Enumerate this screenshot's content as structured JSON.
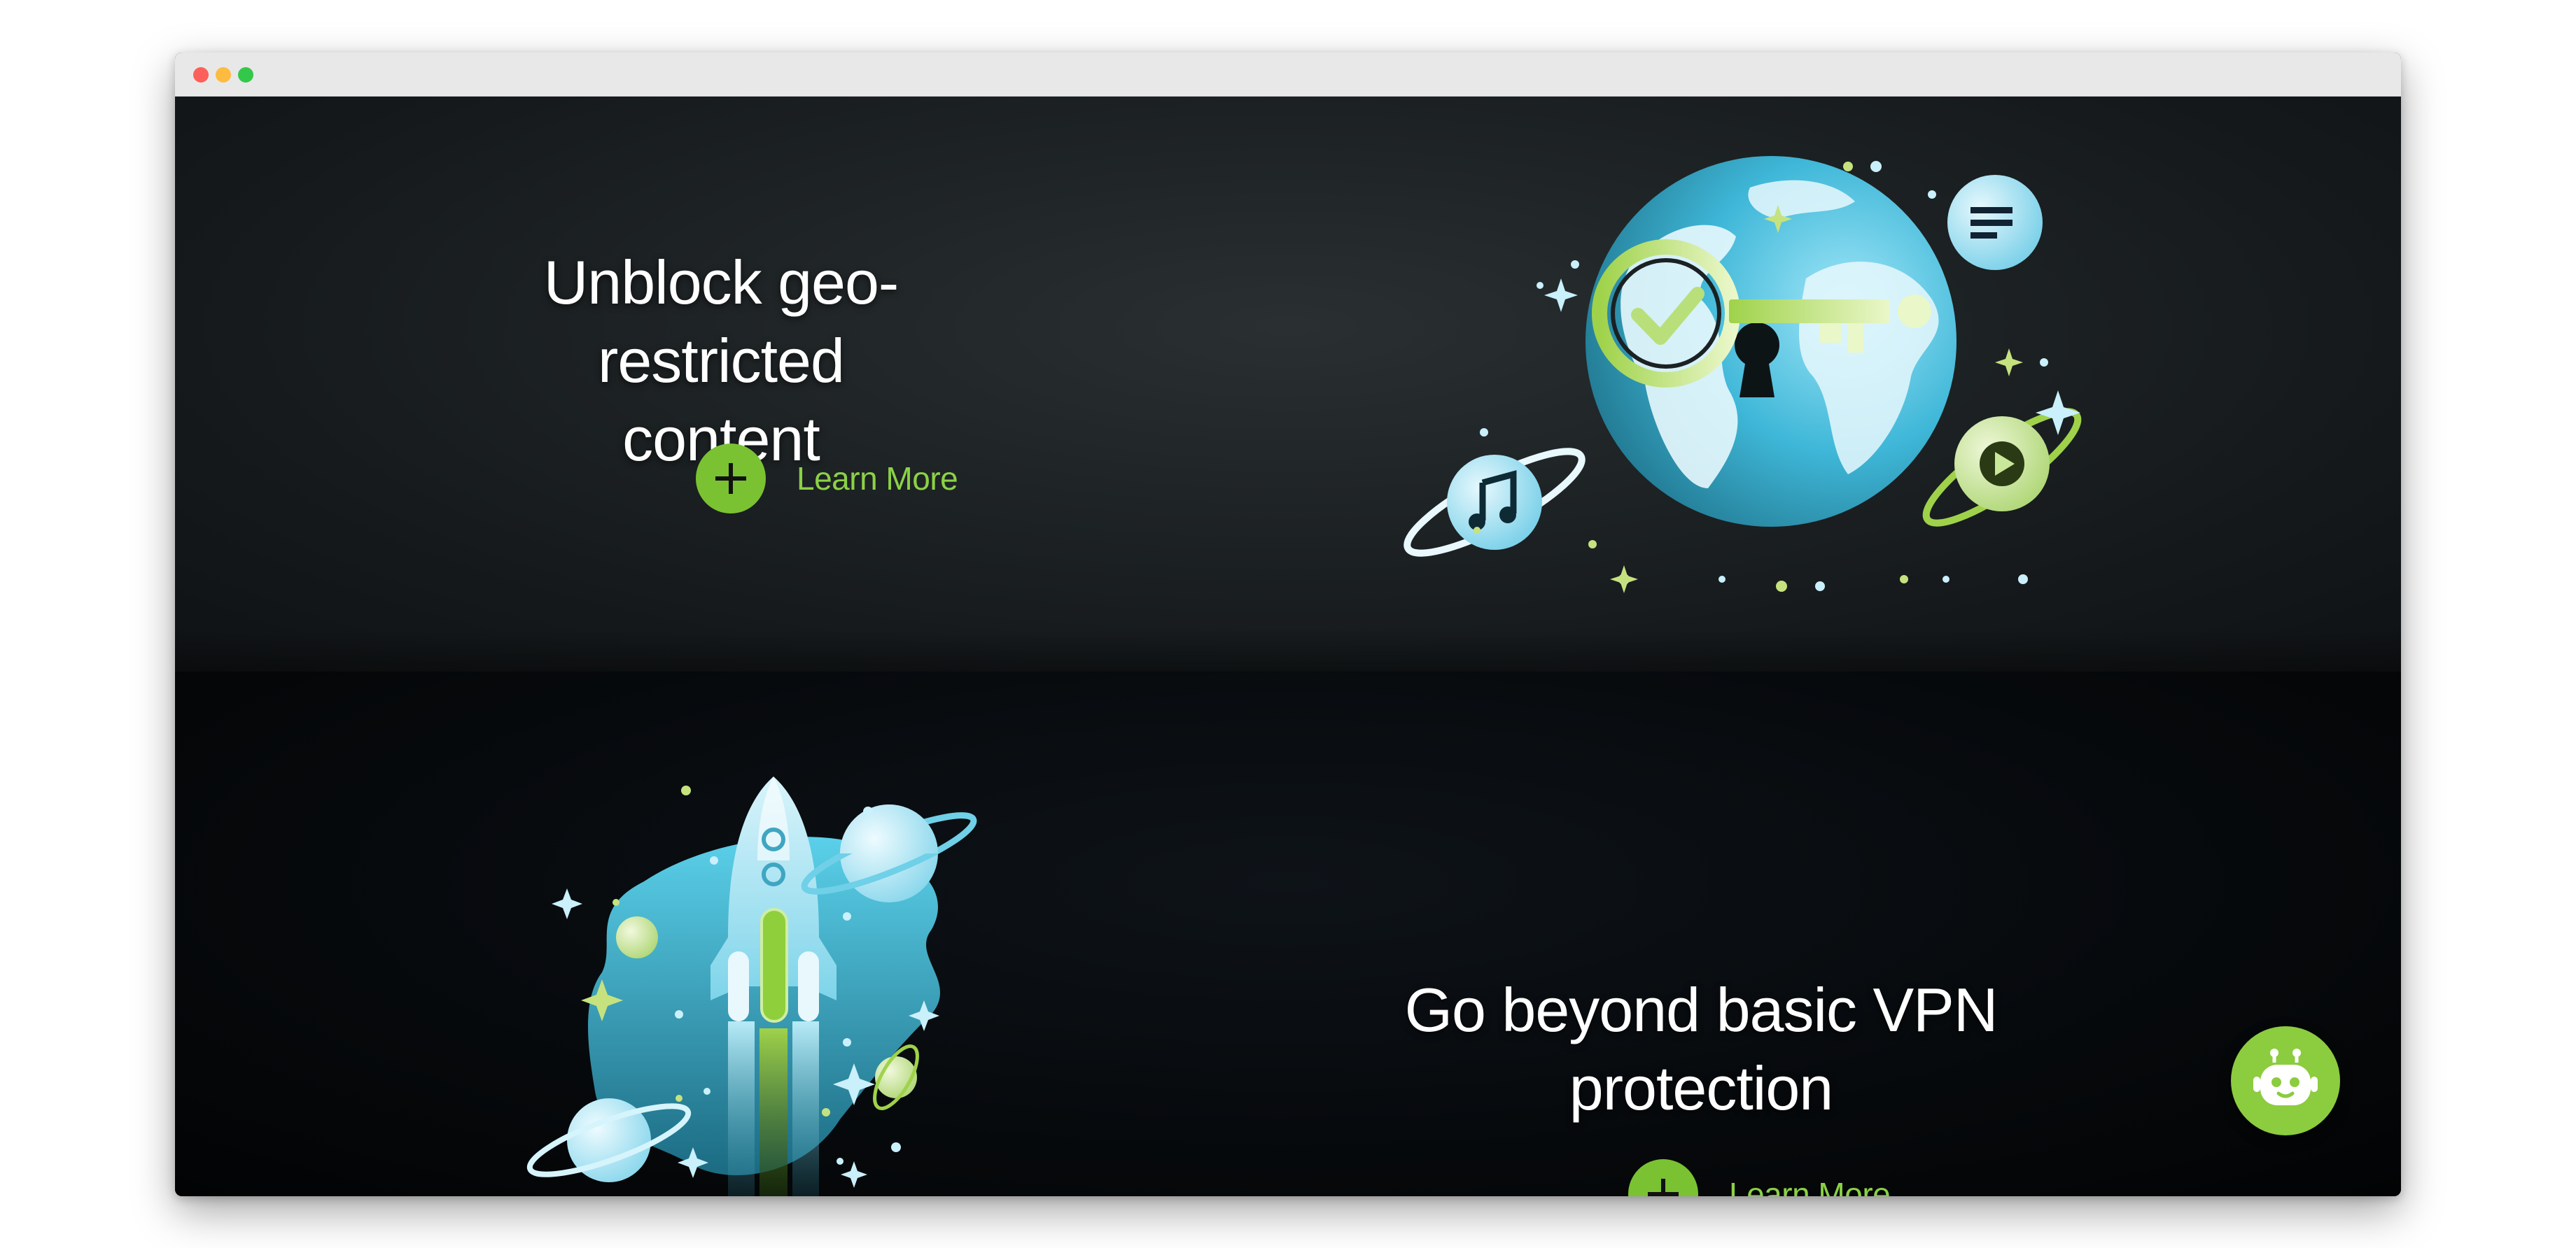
{
  "window": {
    "controls": [
      "close",
      "minimize",
      "zoom"
    ]
  },
  "hero_top": {
    "headline_line1": "Unblock geo-restricted",
    "headline_line2": "content",
    "cta_label": "Learn More",
    "illustration": "globe-key-planets-illustration"
  },
  "hero_bottom": {
    "headline_line1": "Go beyond basic VPN",
    "headline_line2": "protection",
    "cta_label": "Learn More",
    "illustration": "rocket-space-illustration"
  },
  "chat": {
    "icon": "robot-chat-icon"
  },
  "colors": {
    "accent_green": "#7ac232",
    "cta_text_green": "#8bd146",
    "cyan": "#4fc3e0",
    "light_cyan": "#c9f0fb",
    "top_bg": "#1f2426",
    "bottom_bg": "#050709"
  }
}
